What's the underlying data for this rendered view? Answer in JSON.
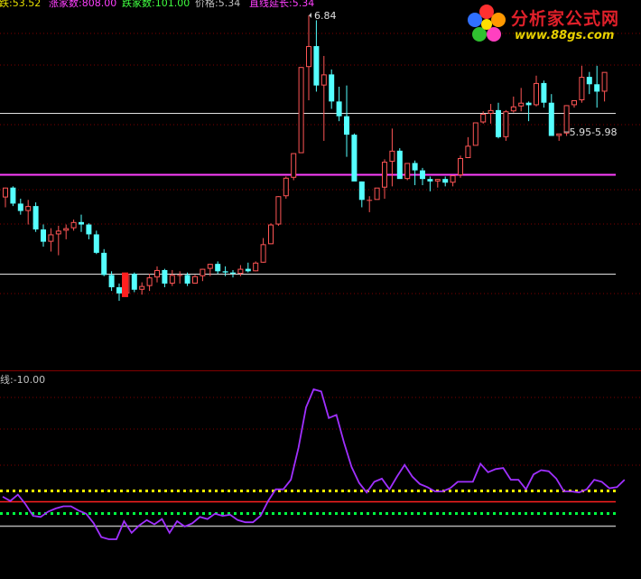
{
  "header": {
    "items": [
      {
        "text": "跌:53.52",
        "color": "#e8e000"
      },
      {
        "text": "涨家数:808.00",
        "color": "#ff40ff"
      },
      {
        "text": "跌家数:101.00",
        "color": "#40ff40"
      },
      {
        "text": "价格:5.34",
        "color": "#c0c0c0"
      },
      {
        "text": "直线延长:5.34",
        "color": "#ff40ff"
      }
    ]
  },
  "indicator_label": "线:-10.00",
  "logo": {
    "title": "分析家公式网",
    "url": "www.88gs.com"
  },
  "colors": {
    "up": "#ff5555",
    "down": "#55ffff",
    "magenta": "#ff40ff",
    "grid_red": "#800000",
    "white": "#e0e0e0",
    "purple": "#a030ff",
    "yellow": "#ffff00",
    "green": "#00ff40",
    "red": "#ff2020",
    "gray": "#b0b0b0"
  },
  "chart_data": [
    {
      "type": "candlestick",
      "annotations": [
        {
          "text": "6.84"
        },
        {
          "text": "5.95-5.98"
        }
      ],
      "reference_lines": [
        {
          "name": "upper white",
          "value": 6.05,
          "color": "#e0e0e0"
        },
        {
          "name": "magenta",
          "value": 5.55,
          "color": "#ff40ff"
        },
        {
          "name": "lower white",
          "value": 4.74,
          "color": "#e0e0e0"
        }
      ],
      "grid": "dotted red horizontal",
      "ohlc": [
        [
          5.36,
          5.44,
          5.28,
          5.44
        ],
        [
          5.44,
          5.45,
          5.29,
          5.31
        ],
        [
          5.31,
          5.35,
          5.22,
          5.25
        ],
        [
          5.25,
          5.34,
          5.14,
          5.29
        ],
        [
          5.29,
          5.32,
          5.08,
          5.1
        ],
        [
          5.1,
          5.14,
          4.96,
          5.0
        ],
        [
          5.0,
          5.11,
          4.92,
          5.06
        ],
        [
          5.06,
          5.13,
          4.89,
          5.09
        ],
        [
          5.09,
          5.14,
          5.02,
          5.11
        ],
        [
          5.11,
          5.18,
          5.09,
          5.16
        ],
        [
          5.16,
          5.22,
          5.08,
          5.14
        ],
        [
          5.14,
          5.15,
          5.02,
          5.06
        ],
        [
          5.06,
          5.09,
          4.9,
          4.91
        ],
        [
          4.91,
          4.94,
          4.72,
          4.73
        ],
        [
          4.73,
          4.76,
          4.6,
          4.63
        ],
        [
          4.63,
          4.66,
          4.52,
          4.58
        ],
        [
          4.58,
          4.74,
          4.55,
          4.74
        ],
        [
          4.74,
          4.75,
          4.59,
          4.61
        ],
        [
          4.61,
          4.67,
          4.57,
          4.64
        ],
        [
          4.64,
          4.74,
          4.6,
          4.71
        ],
        [
          4.71,
          4.8,
          4.67,
          4.77
        ],
        [
          4.77,
          4.78,
          4.63,
          4.66
        ],
        [
          4.66,
          4.77,
          4.64,
          4.73
        ],
        [
          4.73,
          4.76,
          4.66,
          4.73
        ],
        [
          4.73,
          4.75,
          4.64,
          4.66
        ],
        [
          4.66,
          4.73,
          4.66,
          4.72
        ],
        [
          4.72,
          4.78,
          4.68,
          4.78
        ],
        [
          4.78,
          4.82,
          4.72,
          4.82
        ],
        [
          4.82,
          4.84,
          4.74,
          4.76
        ],
        [
          4.76,
          4.8,
          4.72,
          4.75
        ],
        [
          4.75,
          4.77,
          4.71,
          4.74
        ],
        [
          4.74,
          4.81,
          4.72,
          4.78
        ],
        [
          4.78,
          4.83,
          4.75,
          4.76
        ],
        [
          4.76,
          4.84,
          4.76,
          4.83
        ],
        [
          4.83,
          5.03,
          4.83,
          4.98
        ],
        [
          4.98,
          5.15,
          4.98,
          5.14
        ],
        [
          5.14,
          5.37,
          5.13,
          5.37
        ],
        [
          5.37,
          5.53,
          5.35,
          5.52
        ],
        [
          5.52,
          5.72,
          5.5,
          5.72
        ],
        [
          5.72,
          6.42,
          5.74,
          6.42
        ],
        [
          6.42,
          6.84,
          6.15,
          6.59
        ],
        [
          6.59,
          6.8,
          6.22,
          6.27
        ],
        [
          6.27,
          6.51,
          5.82,
          6.36
        ],
        [
          6.36,
          6.4,
          6.08,
          6.14
        ],
        [
          6.14,
          6.26,
          5.98,
          6.02
        ],
        [
          6.02,
          6.27,
          5.69,
          5.87
        ],
        [
          5.87,
          5.88,
          5.5,
          5.49
        ],
        [
          5.49,
          5.49,
          5.28,
          5.34
        ],
        [
          5.34,
          5.37,
          5.24,
          5.34
        ],
        [
          5.34,
          5.36,
          5.35,
          5.44
        ],
        [
          5.44,
          5.67,
          5.35,
          5.65
        ],
        [
          5.65,
          5.92,
          5.45,
          5.74
        ],
        [
          5.74,
          5.76,
          5.56,
          5.51
        ],
        [
          5.51,
          5.6,
          5.5,
          5.64
        ],
        [
          5.64,
          5.66,
          5.46,
          5.58
        ],
        [
          5.58,
          5.6,
          5.46,
          5.51
        ],
        [
          5.51,
          5.53,
          5.41,
          5.49
        ],
        [
          5.49,
          5.51,
          5.44,
          5.51
        ],
        [
          5.51,
          5.53,
          5.45,
          5.48
        ],
        [
          5.48,
          5.52,
          5.45,
          5.54
        ],
        [
          5.54,
          5.7,
          5.52,
          5.68
        ],
        [
          5.68,
          5.85,
          5.68,
          5.78
        ],
        [
          5.78,
          5.97,
          5.97,
          5.97
        ],
        [
          5.97,
          6.06,
          5.96,
          6.04
        ],
        [
          6.04,
          6.12,
          5.96,
          6.07
        ],
        [
          6.07,
          6.13,
          5.84,
          5.85
        ],
        [
          5.85,
          6.07,
          5.82,
          6.06
        ],
        [
          6.06,
          6.18,
          6.05,
          6.1
        ],
        [
          6.1,
          6.25,
          6.06,
          6.13
        ],
        [
          6.13,
          6.14,
          5.98,
          6.11
        ],
        [
          6.11,
          6.35,
          6.1,
          6.29
        ],
        [
          6.29,
          6.31,
          6.09,
          6.13
        ],
        [
          6.13,
          6.2,
          6.0,
          5.86
        ],
        [
          5.86,
          5.87,
          5.82,
          5.88
        ],
        [
          5.88,
          6.11,
          5.86,
          6.11
        ],
        [
          6.11,
          6.14,
          6.09,
          6.15
        ],
        [
          6.15,
          6.43,
          6.13,
          6.34
        ],
        [
          6.34,
          6.38,
          6.2,
          6.28
        ],
        [
          6.28,
          6.43,
          6.09,
          6.22
        ],
        [
          6.22,
          6.27,
          6.14,
          6.38
        ]
      ]
    },
    {
      "type": "line",
      "label": "线:-10.00",
      "reference_lines": [
        {
          "name": "yellow dotted",
          "value": 0,
          "style": "dotted",
          "color": "#ffff00"
        },
        {
          "name": "red",
          "value": -10,
          "style": "solid",
          "color": "#ff2020"
        },
        {
          "name": "green dotted",
          "value": -21,
          "style": "dotted",
          "color": "#00ff40"
        },
        {
          "name": "gray",
          "value": -33,
          "style": "solid",
          "color": "#b0b0b0"
        }
      ],
      "grid": "dotted red horizontal",
      "values": [
        -6,
        -10,
        -4,
        -13,
        -24,
        -25,
        -20,
        -17,
        -15,
        -15,
        -19,
        -22,
        -31,
        -44,
        -46,
        -46,
        -29,
        -40,
        -33,
        -28,
        -32,
        -27,
        -40,
        -29,
        -34,
        -31,
        -25,
        -27,
        -22,
        -24,
        -23,
        -28,
        -30,
        -30,
        -24,
        -10,
        1,
        1,
        10,
        40,
        78,
        95,
        93,
        68,
        71,
        45,
        22,
        7,
        -2,
        8,
        11,
        1,
        13,
        24,
        13,
        6,
        3,
        -1,
        -1,
        2,
        8,
        8,
        8,
        25,
        17,
        20,
        21,
        10,
        10,
        1,
        15,
        19,
        18,
        11,
        -1,
        -1,
        -2,
        1,
        10,
        8,
        2,
        3,
        10
      ]
    }
  ]
}
